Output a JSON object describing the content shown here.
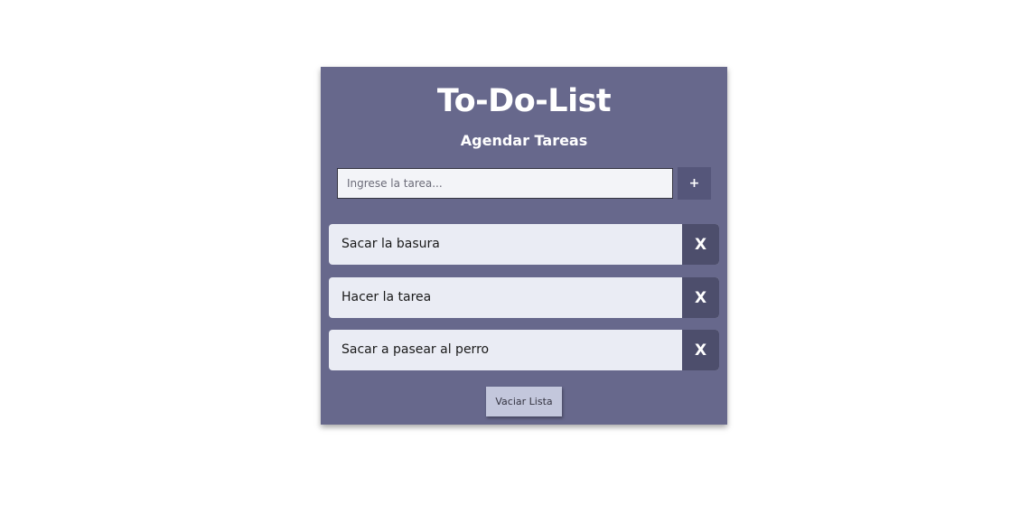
{
  "app": {
    "title": "To-Do-List",
    "subtitle": "Agendar Tareas"
  },
  "input": {
    "placeholder": "Ingrese la tarea...",
    "value": "",
    "add_label": "+"
  },
  "tasks": [
    {
      "label": "Sacar la basura",
      "delete_label": "X"
    },
    {
      "label": "Hacer la tarea",
      "delete_label": "X"
    },
    {
      "label": "Sacar a pasear al perro",
      "delete_label": "X"
    }
  ],
  "clear_button": {
    "label": "Vaciar Lista"
  },
  "colors": {
    "card_background": "#67688c",
    "add_button": "#55567a",
    "delete_button": "#4d4e6c",
    "task_background": "#eaecf4",
    "clear_button": "#c3c7dc"
  }
}
